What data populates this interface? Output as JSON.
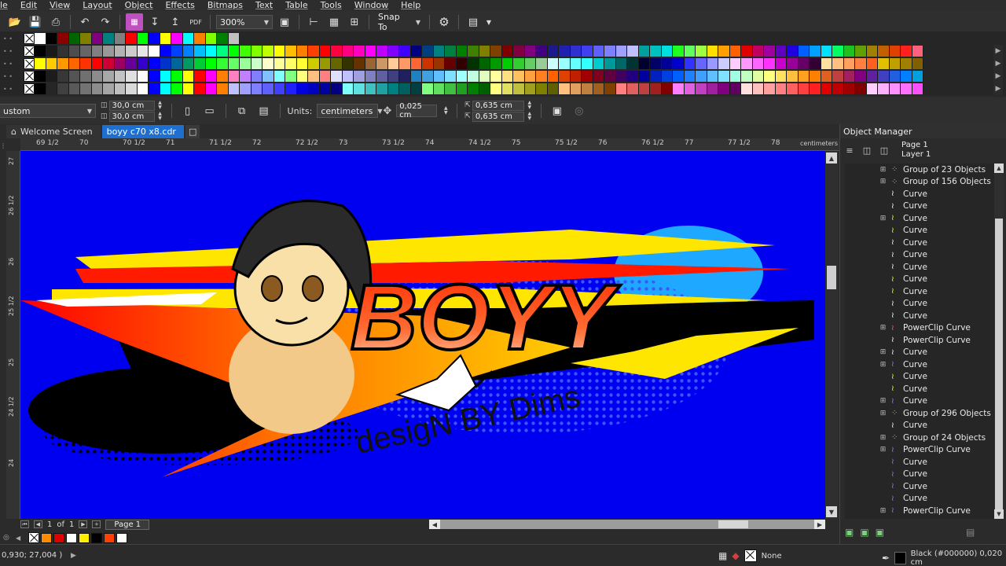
{
  "menu": [
    "le",
    "Edit",
    "View",
    "Layout",
    "Object",
    "Effects",
    "Bitmaps",
    "Text",
    "Table",
    "Tools",
    "Window",
    "Help"
  ],
  "toolbar": {
    "zoom": "300%",
    "snap_label": "Snap To"
  },
  "palettes": {
    "row1": [
      "#ffffff",
      "#000000",
      "#8b0000",
      "#006400",
      "#808000",
      "#800080",
      "#008080",
      "#808080",
      "#ff0000",
      "#00ff00",
      "#0000ff",
      "#ffff00",
      "#ff00ff",
      "#00ffff",
      "#ff8000",
      "#80ff00",
      "#008000",
      "#c0c0c0"
    ],
    "row2": [
      "#000000",
      "#1a1a1a",
      "#333333",
      "#4d4d4d",
      "#666666",
      "#808080",
      "#999999",
      "#b3b3b3",
      "#cccccc",
      "#e6e6e6",
      "#ffffff",
      "#0000ff",
      "#0040ff",
      "#0080ff",
      "#00bfff",
      "#00ffff",
      "#00ff80",
      "#00ff00",
      "#40ff00",
      "#80ff00",
      "#bfff00",
      "#ffff00",
      "#ffbf00",
      "#ff8000",
      "#ff4000",
      "#ff0000",
      "#ff0040",
      "#ff0080",
      "#ff00bf",
      "#ff00ff",
      "#bf00ff",
      "#8000ff",
      "#4000ff",
      "#000080",
      "#004080",
      "#008080",
      "#008040",
      "#008000",
      "#408000",
      "#808000",
      "#804000",
      "#800000",
      "#800040",
      "#800080",
      "#400080",
      "#1a1a8a",
      "#2020b0",
      "#3030d0",
      "#4040f0",
      "#6060ff",
      "#8080ff",
      "#a0a0ff",
      "#c0c0ff",
      "#00a0a0",
      "#00c0c0",
      "#00e0e0",
      "#20ff20",
      "#60ff60",
      "#a0ff40",
      "#ffe000",
      "#ffa000",
      "#ff6000",
      "#e00000",
      "#c00060",
      "#a000a0",
      "#6000c0",
      "#2000e0",
      "#0060ff",
      "#00a0ff",
      "#00e0ff",
      "#00ff60",
      "#20c020",
      "#60a000",
      "#a08000",
      "#c06000",
      "#e04000",
      "#ff2020",
      "#ff6080"
    ],
    "row3": [
      "#ffff00",
      "#ffcc00",
      "#ff9900",
      "#ff6600",
      "#ff3300",
      "#ff0000",
      "#cc0033",
      "#990066",
      "#660099",
      "#3300cc",
      "#0000ff",
      "#0033cc",
      "#006699",
      "#009966",
      "#00cc33",
      "#00ff00",
      "#33ff33",
      "#66ff66",
      "#99ff99",
      "#ccffcc",
      "#ffffcc",
      "#ffff99",
      "#ffff66",
      "#ffff33",
      "#cccc00",
      "#999900",
      "#666600",
      "#333300",
      "#663300",
      "#996633",
      "#cc9966",
      "#ffcc99",
      "#ff9966",
      "#ff6633",
      "#cc3300",
      "#993300",
      "#660000",
      "#330000",
      "#003300",
      "#006600",
      "#009900",
      "#00cc00",
      "#33cc33",
      "#66cc66",
      "#99cc99",
      "#ccffff",
      "#99ffff",
      "#66ffff",
      "#33ffff",
      "#00cccc",
      "#009999",
      "#006666",
      "#003333",
      "#000033",
      "#000066",
      "#000099",
      "#0000cc",
      "#3333ff",
      "#6666ff",
      "#9999ff",
      "#ccccff",
      "#ffccff",
      "#ff99ff",
      "#ff66ff",
      "#ff33ff",
      "#cc00cc",
      "#990099",
      "#660066",
      "#330033",
      "#ffe0a0",
      "#ffc080",
      "#ffa060",
      "#ff8040",
      "#ff6020",
      "#e0c000",
      "#c0a000",
      "#a08000",
      "#806000"
    ],
    "row4": [
      "#000000",
      "#1c1c1c",
      "#383838",
      "#545454",
      "#707070",
      "#8c8c8c",
      "#a8a8a8",
      "#c4c4c4",
      "#e0e0e0",
      "#fcfcfc",
      "#0000ff",
      "#00ffff",
      "#00ff00",
      "#ffff00",
      "#ff0000",
      "#ff00ff",
      "#ff8000",
      "#ff80c0",
      "#c080ff",
      "#8080ff",
      "#80c0ff",
      "#80ffff",
      "#80ff80",
      "#ffff80",
      "#ffc080",
      "#ff8080",
      "#e0e0ff",
      "#c0c0ff",
      "#a0a0e0",
      "#8080c0",
      "#6060a0",
      "#404080",
      "#202060",
      "#2080c0",
      "#40a0e0",
      "#60c0ff",
      "#80e0ff",
      "#a0ffff",
      "#c0ffe0",
      "#e0ffc0",
      "#ffffa0",
      "#ffe080",
      "#ffc060",
      "#ffa040",
      "#ff8020",
      "#ff6000",
      "#e04000",
      "#c02000",
      "#a00000",
      "#800020",
      "#600040",
      "#400060",
      "#200080",
      "#0000a0",
      "#0020c0",
      "#0040e0",
      "#0060ff",
      "#2080ff",
      "#40a0ff",
      "#60c0ff",
      "#80e0ff",
      "#a0ffe0",
      "#c0ffc0",
      "#e0ffa0",
      "#ffff80",
      "#ffe060",
      "#ffc040",
      "#ffa020",
      "#ff8000",
      "#e06020",
      "#c04040",
      "#a02060",
      "#800080",
      "#6020a0",
      "#4040c0",
      "#2060e0",
      "#0080ff",
      "#00a0e0"
    ],
    "row5": [
      "#000000",
      "#262626",
      "#404040",
      "#595959",
      "#737373",
      "#8c8c8c",
      "#a6a6a6",
      "#bfbfbf",
      "#d9d9d9",
      "#ffffff",
      "#0000ff",
      "#00ffff",
      "#00ff00",
      "#ffff00",
      "#ff0000",
      "#ff00ff",
      "#ff8000",
      "#c0c0ff",
      "#a0a0ff",
      "#8080ff",
      "#6060ff",
      "#4040ff",
      "#2020ff",
      "#0000e0",
      "#0000c0",
      "#0000a0",
      "#000080",
      "#80ffff",
      "#60e0e0",
      "#40c0c0",
      "#20a0a0",
      "#008080",
      "#006060",
      "#004040",
      "#80ff80",
      "#60e060",
      "#40c040",
      "#20a020",
      "#008000",
      "#006000",
      "#ffff80",
      "#e0e060",
      "#c0c040",
      "#a0a020",
      "#808000",
      "#606000",
      "#ffc080",
      "#e0a060",
      "#c08040",
      "#a06020",
      "#804000",
      "#ff8080",
      "#e06060",
      "#c04040",
      "#a02020",
      "#800000",
      "#ff80ff",
      "#e060e0",
      "#c040c0",
      "#a020a0",
      "#800080",
      "#600060",
      "#ffe0e0",
      "#ffc0c0",
      "#ffa0a0",
      "#ff8080",
      "#ff6060",
      "#ff4040",
      "#ff2020",
      "#e00000",
      "#c00000",
      "#a00000",
      "#800000",
      "#ffd0ff",
      "#ffb0ff",
      "#ff90ff",
      "#ff70ff",
      "#ff50ff"
    ]
  },
  "propbar": {
    "preset": "ustom",
    "width": "30,0 cm",
    "height": "30,0 cm",
    "units_label": "Units:",
    "units": "centimeters",
    "nudge": "0,025 cm",
    "dup_x": "0,635 cm",
    "dup_y": "0,635 cm"
  },
  "doc_tabs": [
    {
      "label": "Welcome Screen",
      "icon": "home-icon"
    },
    {
      "label": "boyy c70 x8.cdr",
      "icon": "document-icon"
    }
  ],
  "ruler": {
    "h_labels": [
      "69 1/2",
      "70",
      "70 1/2",
      "71",
      "71 1/2",
      "72",
      "72 1/2",
      "73",
      "73 1/2",
      "74",
      "74 1/2",
      "75",
      "75 1/2",
      "76",
      "76 1/2",
      "77",
      "77 1/2",
      "78"
    ],
    "unit": "centimeters",
    "v_labels": [
      "27",
      "26 1/2",
      "26",
      "25 1/2",
      "25",
      "24 1/2",
      "24"
    ]
  },
  "artwork": {
    "title": "BOYY",
    "subtitle": "desigN BY Dims",
    "background": "#0000f0"
  },
  "page_nav": {
    "current": "1",
    "of_label": "of",
    "total": "1",
    "page_tab": "Page 1"
  },
  "doc_palette": [
    "#ff8c00",
    "#e00000",
    "#ffffff",
    "#ffee00",
    "#000000",
    "#ff4000",
    "#ffffff"
  ],
  "status": {
    "coords": "0,930; 27,004 )",
    "fill_label": "None",
    "outline_label": "Black (#000000)  0,020 cm"
  },
  "object_manager": {
    "title": "Object Manager",
    "page": "Page 1",
    "layer": "Layer 1",
    "items": [
      {
        "label": "Group of 23 Objects",
        "expand": true,
        "icon": "group-icon",
        "color": "#aaaaaa"
      },
      {
        "label": "Group of 156 Objects",
        "expand": true,
        "icon": "group-icon",
        "color": "#aaaaaa"
      },
      {
        "label": "Curve",
        "expand": false,
        "icon": "curve-icon",
        "color": "#ffffff"
      },
      {
        "label": "Curve",
        "expand": false,
        "icon": "curve-icon",
        "color": "#ffffff"
      },
      {
        "label": "Curve",
        "expand": true,
        "icon": "curve-icon",
        "color": "#ffff00"
      },
      {
        "label": "Curve",
        "expand": false,
        "icon": "curve-icon",
        "color": "#ffff00"
      },
      {
        "label": "Curve",
        "expand": false,
        "icon": "curve-icon",
        "color": "#ffffff"
      },
      {
        "label": "Curve",
        "expand": false,
        "icon": "curve-icon",
        "color": "#ffffff"
      },
      {
        "label": "Curve",
        "expand": false,
        "icon": "curve-icon",
        "color": "#ffffff"
      },
      {
        "label": "Curve",
        "expand": false,
        "icon": "curve-icon",
        "color": "#ffff00"
      },
      {
        "label": "Curve",
        "expand": false,
        "icon": "curve-icon",
        "color": "#ffff00"
      },
      {
        "label": "Curve",
        "expand": false,
        "icon": "curve-icon",
        "color": "#ffffff"
      },
      {
        "label": "Curve",
        "expand": false,
        "icon": "curve-icon",
        "color": "#ffffff"
      },
      {
        "label": "PowerClip Curve",
        "expand": true,
        "icon": "powerclip-icon",
        "color": "#ff6060"
      },
      {
        "label": "PowerClip Curve",
        "expand": false,
        "icon": "powerclip-icon",
        "color": "#ffffff"
      },
      {
        "label": "Curve",
        "expand": true,
        "icon": "curve-icon",
        "color": "#ffffff"
      },
      {
        "label": "Curve",
        "expand": true,
        "icon": "curve-icon",
        "color": "#8080ff"
      },
      {
        "label": "Curve",
        "expand": false,
        "icon": "curve-icon",
        "color": "#ffff00"
      },
      {
        "label": "Curve",
        "expand": false,
        "icon": "curve-icon",
        "color": "#ffff00"
      },
      {
        "label": "Curve",
        "expand": true,
        "icon": "curve-icon",
        "color": "#8080ff"
      },
      {
        "label": "Group of 296 Objects",
        "expand": true,
        "icon": "group-icon",
        "color": "#aaaaaa"
      },
      {
        "label": "Curve",
        "expand": false,
        "icon": "curve-icon",
        "color": "#ffffff"
      },
      {
        "label": "Group of 24 Objects",
        "expand": true,
        "icon": "group-icon",
        "color": "#aaaaaa"
      },
      {
        "label": "PowerClip Curve",
        "expand": true,
        "icon": "powerclip-icon",
        "color": "#8080ff"
      },
      {
        "label": "Curve",
        "expand": false,
        "icon": "curve-icon",
        "color": "#8080ff"
      },
      {
        "label": "Curve",
        "expand": false,
        "icon": "curve-icon",
        "color": "#8080ff"
      },
      {
        "label": "Curve",
        "expand": false,
        "icon": "curve-icon",
        "color": "#8080ff"
      },
      {
        "label": "Curve",
        "expand": false,
        "icon": "curve-icon",
        "color": "#8080ff"
      },
      {
        "label": "PowerClip Curve",
        "expand": true,
        "icon": "powerclip-icon",
        "color": "#8080ff"
      }
    ]
  }
}
